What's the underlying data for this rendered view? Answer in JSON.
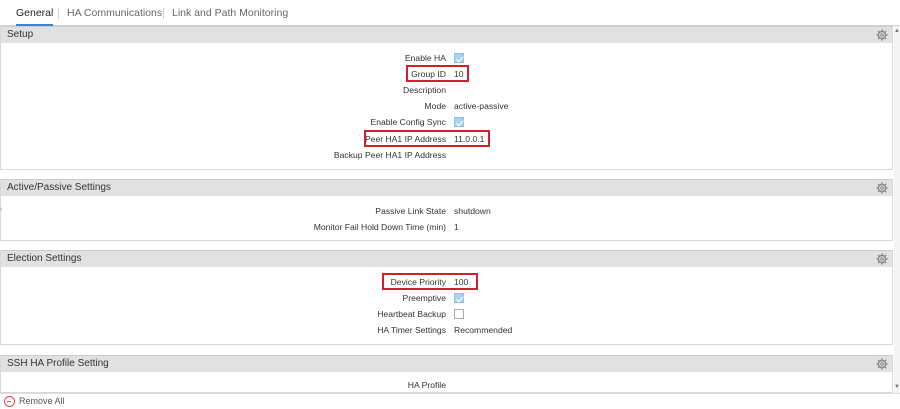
{
  "tabs": [
    {
      "label": "General",
      "active": true
    },
    {
      "label": "HA Communications",
      "active": false
    },
    {
      "label": "Link and Path Monitoring",
      "active": false
    }
  ],
  "setup": {
    "title": "Setup",
    "enable_ha_label": "Enable HA",
    "enable_ha_checked": true,
    "group_id_label": "Group ID",
    "group_id_value": "10",
    "description_label": "Description",
    "description_value": "",
    "mode_label": "Mode",
    "mode_value": "active-passive",
    "config_sync_label": "Enable Config Sync",
    "config_sync_checked": true,
    "peer_ha1_label": "Peer HA1 IP Address",
    "peer_ha1_value": "11.0.0.1",
    "backup_peer_label": "Backup Peer HA1 IP Address",
    "backup_peer_value": ""
  },
  "active_passive": {
    "title": "Active/Passive Settings",
    "passive_link_label": "Passive Link State",
    "passive_link_value": "shutdown",
    "hold_down_label": "Monitor Fail Hold Down Time (min)",
    "hold_down_value": "1"
  },
  "election": {
    "title": "Election Settings",
    "priority_label": "Device Priority",
    "priority_value": "100",
    "preemptive_label": "Preemptive",
    "preemptive_checked": true,
    "heartbeat_label": "Heartbeat Backup",
    "heartbeat_checked": false,
    "timer_label": "HA Timer Settings",
    "timer_value": "Recommended"
  },
  "ssh_profile": {
    "title": "SSH HA Profile Setting",
    "profile_label": "HA Profile",
    "profile_value": ""
  },
  "footer": {
    "remove_all_label": "Remove All"
  },
  "colors": {
    "highlight": "#d0202e",
    "checkbox_on": "#a9d3ee",
    "header_bg": "#e1e1e1",
    "tab_accent": "#3d85c6"
  },
  "icons": {
    "panel_settings": "gear-icon",
    "remove": "minus-circle-icon"
  }
}
